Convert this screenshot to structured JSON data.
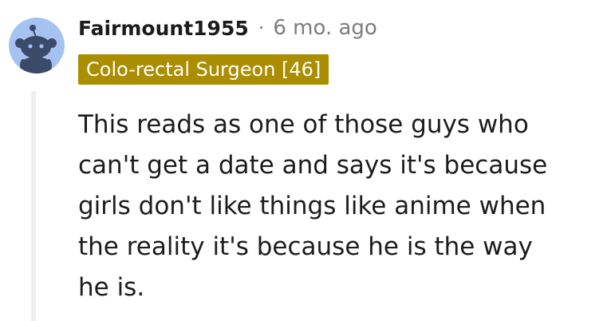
{
  "comment": {
    "username": "Fairmount1955",
    "separator": "·",
    "timestamp": "6 mo. ago",
    "flair": "Colo-rectal Surgeon [46]",
    "body_lines": [
      "This reads as one of those guys who",
      "can't get a date and says it's because",
      "girls don't like things like anime when",
      "the reality it's because he is the way",
      "he is."
    ]
  },
  "colors": {
    "flair_background": "#ab8d00",
    "flair_text": "#ffffff",
    "avatar_background": "#a5c2f0",
    "thread_line": "#edeff1",
    "meta_gray": "#7c7c7c",
    "text": "#1c1c1c"
  },
  "icons": {
    "avatar": "snoo-avatar-icon"
  }
}
